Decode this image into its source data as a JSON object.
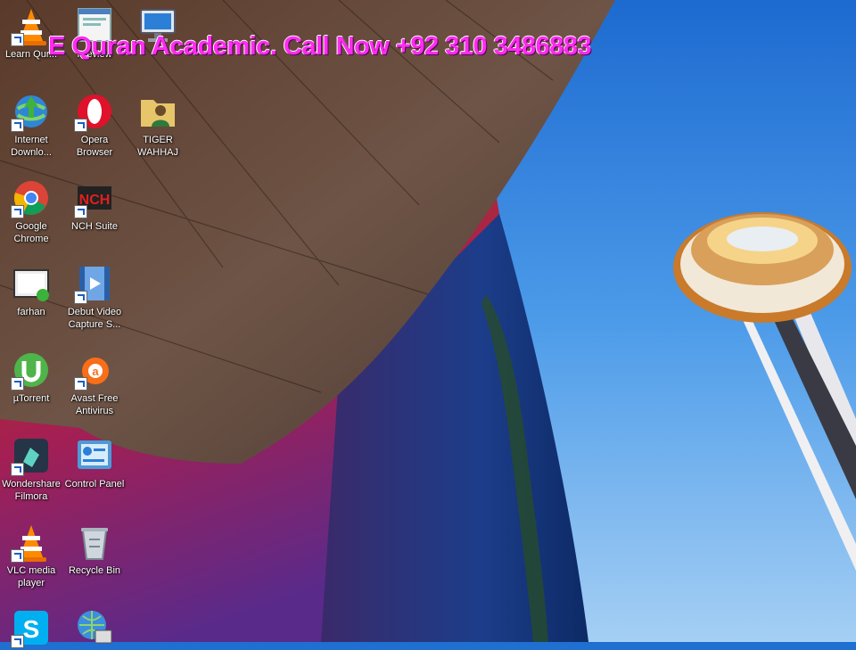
{
  "overlay": {
    "text": "E Quran Academic. Call Now  +92 310 3486883",
    "color": "#ff2bf0"
  },
  "desktop": {
    "icons": [
      {
        "id": "learn-quran",
        "label": "Learn Qur...",
        "icon": "vlc-cone-icon"
      },
      {
        "id": "preview",
        "label": "Preview",
        "icon": "preview-window-icon"
      },
      {
        "id": "this-pc",
        "label": "",
        "icon": "computer-monitor-icon"
      },
      {
        "id": "internet-download",
        "label": "Internet Downlo...",
        "icon": "idm-globe-icon"
      },
      {
        "id": "opera",
        "label": "Opera Browser",
        "icon": "opera-icon"
      },
      {
        "id": "tiger-wahhaj",
        "label": "TIGER WAHHAJ",
        "icon": "user-folder-icon"
      },
      {
        "id": "google-chrome",
        "label": "Google Chrome",
        "icon": "chrome-icon"
      },
      {
        "id": "nch-suite",
        "label": "NCH Suite",
        "icon": "nch-icon"
      },
      {
        "id": "farhan",
        "label": "farhan",
        "icon": "video-file-icon"
      },
      {
        "id": "debut-video",
        "label": "Debut Video Capture S...",
        "icon": "film-strip-icon"
      },
      {
        "id": "utorrent",
        "label": "µTorrent",
        "icon": "utorrent-icon"
      },
      {
        "id": "avast",
        "label": "Avast Free Antivirus",
        "icon": "avast-icon"
      },
      {
        "id": "filmora",
        "label": "Wondershare Filmora",
        "icon": "filmora-icon"
      },
      {
        "id": "control-panel",
        "label": "Control Panel",
        "icon": "control-panel-icon"
      },
      {
        "id": "vlc",
        "label": "VLC media player",
        "icon": "vlc-cone-icon"
      },
      {
        "id": "recycle-bin",
        "label": "Recycle Bin",
        "icon": "recycle-bin-icon"
      },
      {
        "id": "skype",
        "label": "",
        "icon": "skype-icon"
      },
      {
        "id": "network",
        "label": "",
        "icon": "network-globe-icon"
      }
    ]
  }
}
